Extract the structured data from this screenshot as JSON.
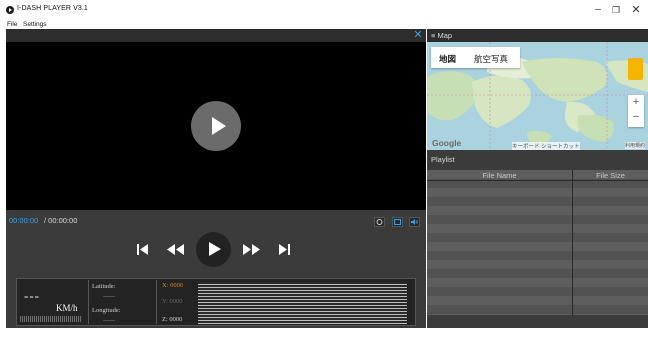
{
  "window": {
    "title": "I-DASH PLAYER V3.1",
    "minimize_glyph": "–",
    "maximize_glyph": "❐",
    "close_glyph": "✕"
  },
  "menu": {
    "file_label": "File",
    "settings_label": "Settings"
  },
  "player": {
    "time_current": "00:00:00",
    "time_total": "/ 00:00:00",
    "accent_color": "#3aa0e8"
  },
  "telemetry": {
    "speed_value": "---",
    "speed_unit": "KM/h",
    "latitude_label": "Latitude:",
    "latitude_value": "------",
    "longitude_label": "Longitude:",
    "longitude_value": "------",
    "x_label": "X: 0000",
    "y_label": "Y: 0000",
    "z_label": "Z: 0000",
    "x_color": "#d9882a"
  },
  "map": {
    "panel_title": "≡ Map",
    "type_map": "地図",
    "type_satellite": "航空写真",
    "zoom_in": "+",
    "zoom_out": "−",
    "logo": "Google",
    "attribution": "キーボード ショートカット",
    "terms": "利用規約"
  },
  "playlist": {
    "panel_title": "Playlist",
    "columns": [
      "File Name",
      "File Size"
    ]
  }
}
